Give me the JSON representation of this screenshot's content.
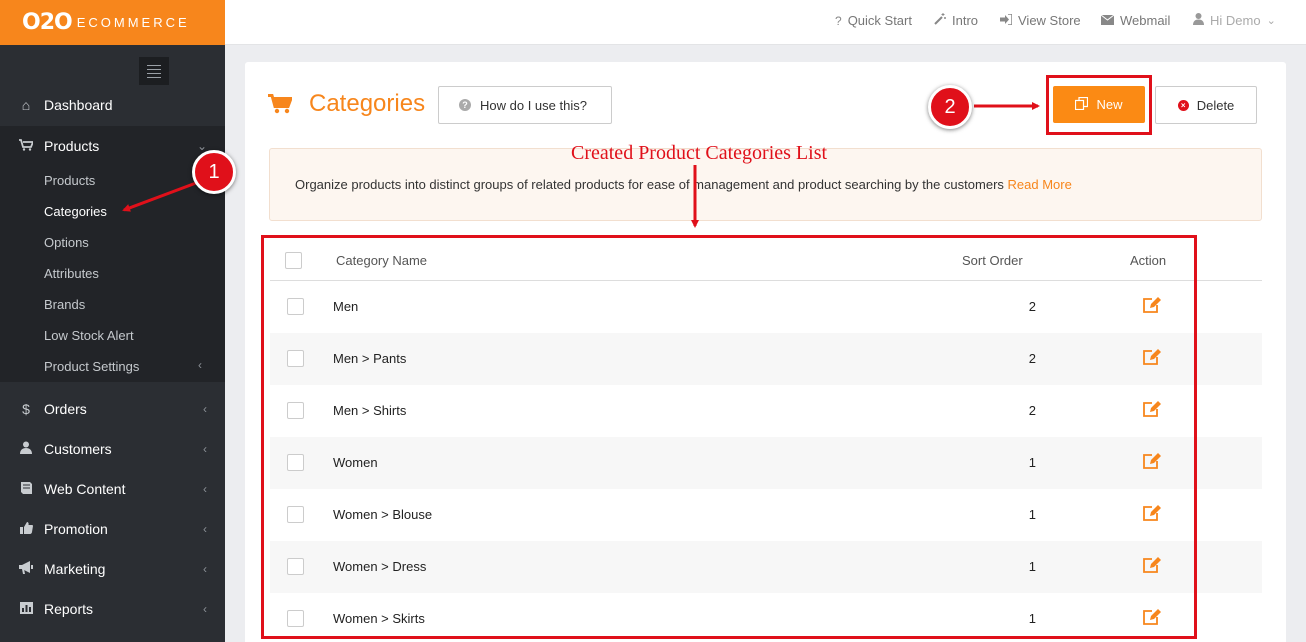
{
  "brand": {
    "logo_main": "O2O",
    "logo_sub": "ECOMMERCE"
  },
  "topbar": {
    "links": [
      {
        "label": "Quick Start",
        "icon": "question-icon"
      },
      {
        "label": "Intro",
        "icon": "magic-wand-icon"
      },
      {
        "label": "View Store",
        "icon": "sign-in-icon"
      },
      {
        "label": "Webmail",
        "icon": "envelope-icon"
      },
      {
        "label": "Hi Demo",
        "icon": "user-icon"
      }
    ]
  },
  "sidebar": {
    "dashboard": "Dashboard",
    "products": "Products",
    "product_sub": [
      "Products",
      "Categories",
      "Options",
      "Attributes",
      "Brands",
      "Low Stock Alert",
      "Product Settings"
    ],
    "orders": "Orders",
    "customers": "Customers",
    "web_content": "Web Content",
    "promotion": "Promotion",
    "marketing": "Marketing",
    "reports": "Reports"
  },
  "page": {
    "title": "Categories",
    "help_label": "How do I use this?",
    "new_label": "New",
    "delete_label": "Delete",
    "info_text": "Organize products into distinct groups of related products for ease of management and product searching by the customers",
    "read_more": "Read More"
  },
  "annotations": {
    "list_title": "Created Product Categories List",
    "badge_1": "1",
    "badge_2": "2",
    "color": "#e0101a"
  },
  "table": {
    "headers": {
      "name": "Category Name",
      "sort": "Sort Order",
      "action": "Action"
    },
    "rows": [
      {
        "name": "Men",
        "sort": "2"
      },
      {
        "name": "Men > Pants",
        "sort": "2"
      },
      {
        "name": "Men > Shirts",
        "sort": "2"
      },
      {
        "name": "Women",
        "sort": "1"
      },
      {
        "name": "Women > Blouse",
        "sort": "1"
      },
      {
        "name": "Women > Dress",
        "sort": "1"
      },
      {
        "name": "Women > Skirts",
        "sort": "1"
      }
    ]
  },
  "colors": {
    "accent": "#f7861c",
    "sidebar": "#2b2e33"
  }
}
